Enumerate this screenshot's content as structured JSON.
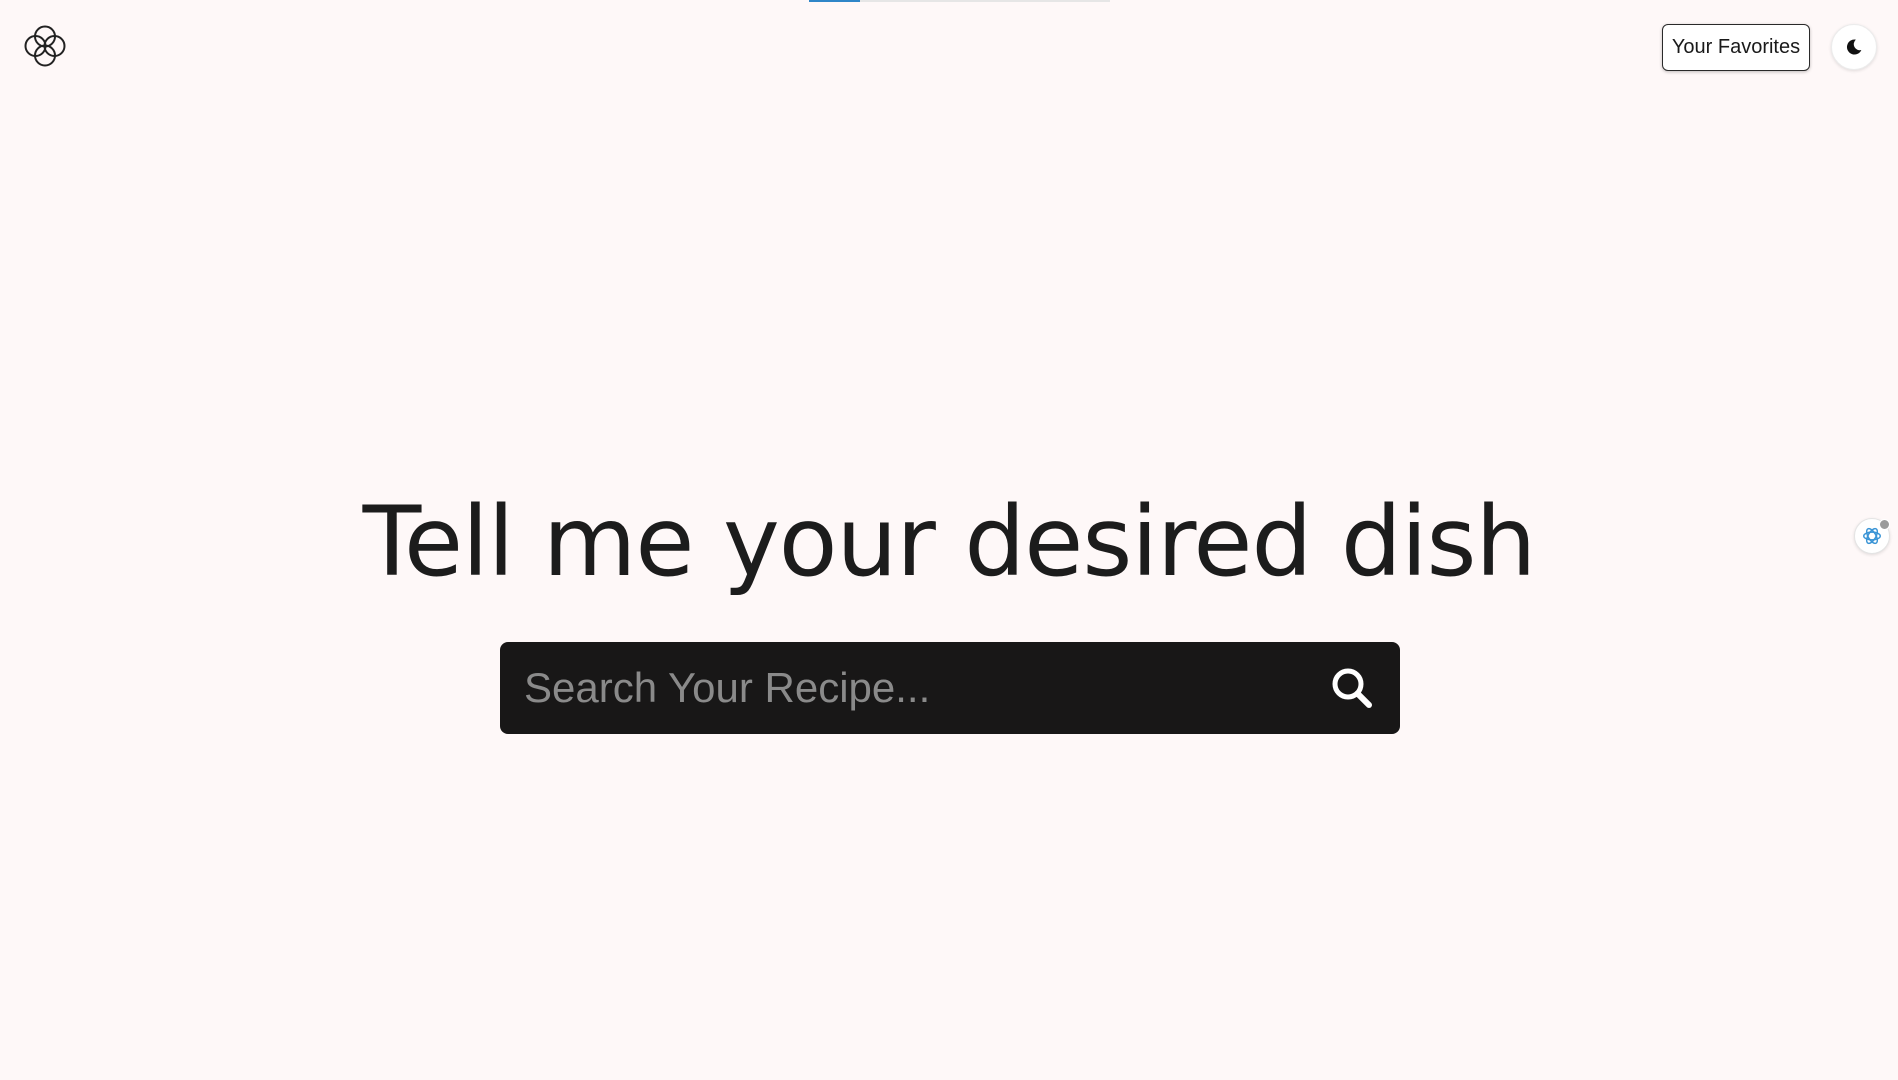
{
  "colors": {
    "background": "#fef8f8",
    "text": "#1c1c1c",
    "search_bg": "#181717",
    "accent": "#2f86c8"
  },
  "loading_bar": {
    "progress": 0.17
  },
  "header": {
    "logo_icon": "flower-logo-icon",
    "favorites_label": "Your Favorites",
    "theme_toggle_icon": "moon-icon"
  },
  "hero": {
    "headline": "Tell me your desired dish"
  },
  "search": {
    "placeholder": "Search Your Recipe...",
    "value": "",
    "icon": "search-icon"
  },
  "side_widget": {
    "icon": "assistant-icon"
  }
}
